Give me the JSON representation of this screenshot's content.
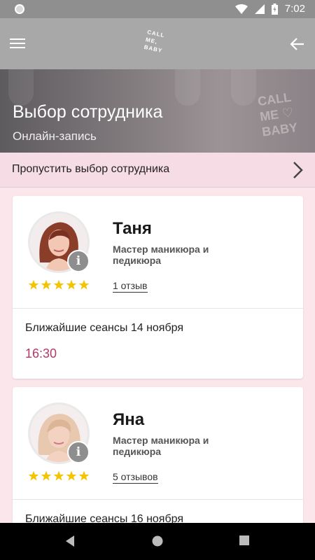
{
  "status_bar": {
    "time": "7:02"
  },
  "app_bar": {
    "logo_lines": [
      "CALL",
      "ME,",
      "BABY"
    ]
  },
  "hero": {
    "title": "Выбор сотрудника",
    "subtitle": "Онлайн-запись"
  },
  "skip": {
    "label": "Пропустить выбор сотрудника"
  },
  "employees": [
    {
      "name": "Таня",
      "role": "Мастер маникюра и педикюра",
      "rating": 5,
      "reviews": "1 отзыв",
      "sessions_label": "Ближайшие сеансы 14 ноября",
      "slots": [
        "16:30"
      ]
    },
    {
      "name": "Яна",
      "role": "Мастер маникюра и педикюра",
      "rating": 5,
      "reviews": "5 отзывов",
      "sessions_label": "Ближайшие сеансы 16 ноября",
      "slots": []
    }
  ],
  "colors": {
    "accent": "#b23a6a",
    "star": "#f5c400",
    "app_bar": "#a8a8a8",
    "status_bar": "#8f8f8f",
    "background": "#fbe6ec"
  }
}
